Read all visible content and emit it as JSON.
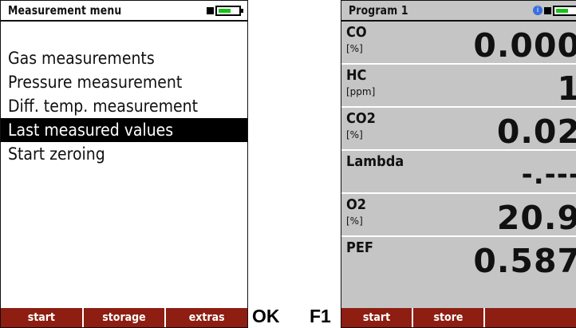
{
  "left_screen": {
    "title": "Measurement menu",
    "menu": [
      {
        "label": "Gas measurements",
        "selected": false
      },
      {
        "label": "Pressure measurement",
        "selected": false
      },
      {
        "label": "Diff. temp. measurement",
        "selected": false
      },
      {
        "label": "Last measured values",
        "selected": true
      },
      {
        "label": "Start zeroing",
        "selected": false
      }
    ],
    "softkeys": [
      "start",
      "storage",
      "extras"
    ]
  },
  "key_labels": {
    "ok": "OK",
    "f1": "F1"
  },
  "right_screen": {
    "title": "Program 1",
    "rows": [
      {
        "name": "CO",
        "unit": "[%]",
        "value": "0.000"
      },
      {
        "name": "HC",
        "unit": "[ppm]",
        "value": "1"
      },
      {
        "name": "CO2",
        "unit": "[%]",
        "value": "0.02"
      },
      {
        "name": "Lambda",
        "unit": "",
        "value": "-.---"
      },
      {
        "name": "O2",
        "unit": "[%]",
        "value": "20.9"
      },
      {
        "name": "PEF",
        "unit": "",
        "value": "0.587"
      }
    ],
    "softkeys": [
      "start",
      "store",
      ""
    ]
  },
  "colors": {
    "softkey_bar": "#8e1d12",
    "battery_fill": "#19c219",
    "right_background": "#c5c5c5",
    "info_icon": "#3a6fe0"
  },
  "icons": {
    "battery": "battery-icon",
    "info": "info-icon"
  }
}
